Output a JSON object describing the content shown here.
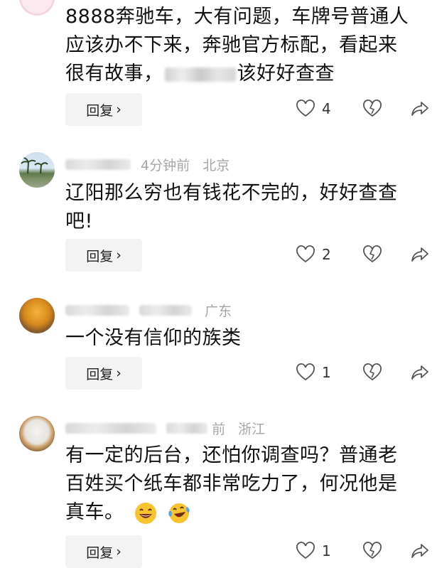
{
  "comments": [
    {
      "author": "",
      "time": "",
      "location": "",
      "lines": [
        "8888奔驰车，大有问题，车牌号普通人",
        "应该办不下来，奔驰官方标配，看起来",
        "很有故事，"
      ],
      "line3_tail": "该好好查查",
      "reply_label": "回复",
      "likes": "4"
    },
    {
      "author": "",
      "time": "4分钟前",
      "location": "北京",
      "lines": [
        "辽阳那么穷也有钱花不完的，好好查查",
        "吧!"
      ],
      "reply_label": "回复",
      "likes": "2"
    },
    {
      "author": "",
      "time": "",
      "location": "广东",
      "lines": [
        "一个没有信仰的族类"
      ],
      "reply_label": "回复",
      "likes": "1"
    },
    {
      "author": "",
      "time": "前",
      "location": "浙江",
      "lines": [
        "有一定的后台，还怕你调查吗？普通老",
        "百姓买个纸车都非常吃力了，何况他是",
        "真车。"
      ],
      "reply_label": "回复",
      "likes": "1"
    }
  ],
  "colors": {
    "meta": "#a6a6a6",
    "text": "#111111",
    "reply_bg": "#f3f3f3",
    "icon": "#555555"
  },
  "icons": {
    "like": "heart-outline-icon",
    "dislike": "broken-heart-icon",
    "share": "share-arrow-icon",
    "emoji1": "laughing-emoji-icon",
    "emoji2": "crying-laughing-emoji-icon"
  }
}
